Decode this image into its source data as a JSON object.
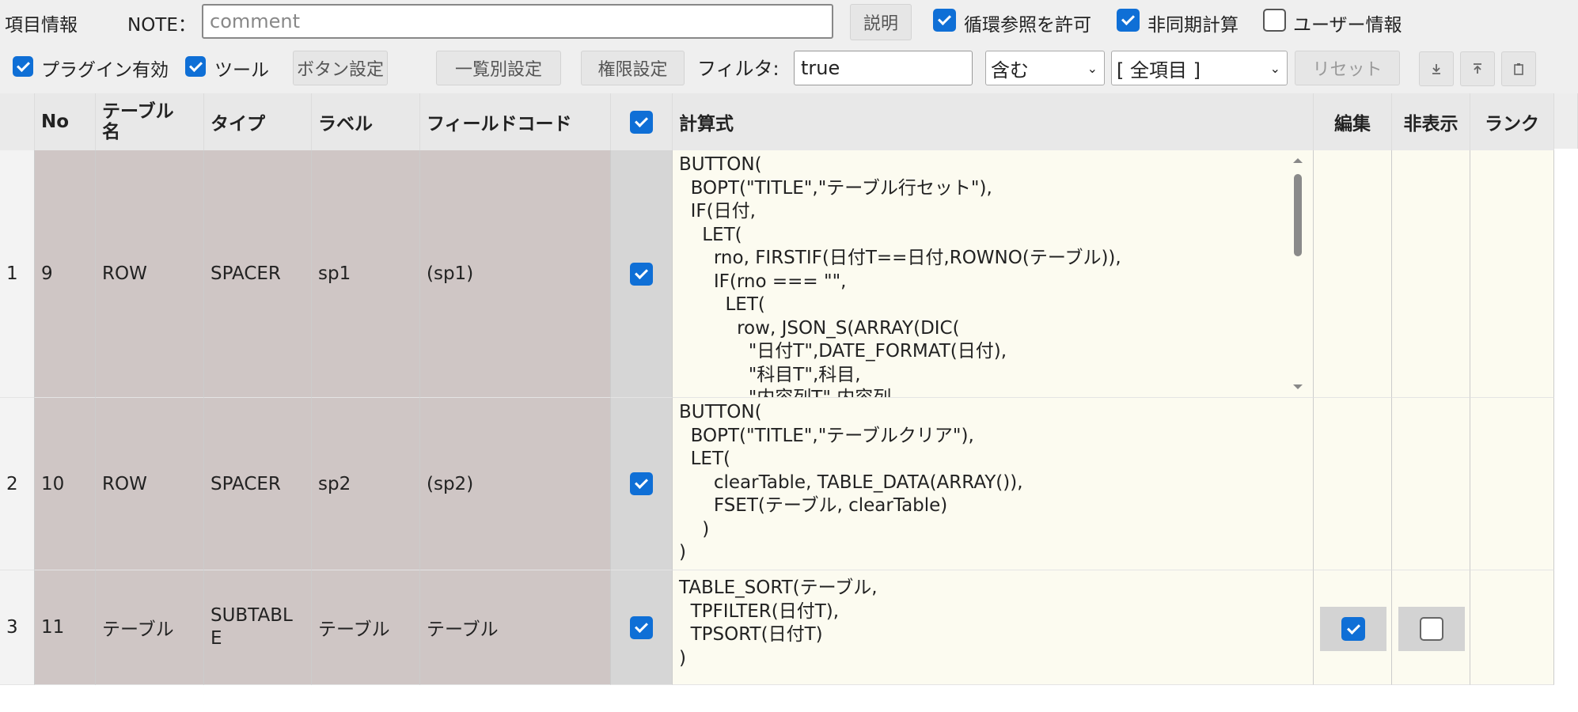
{
  "toolbar1": {
    "item_info_label": "項目情報",
    "note_label": "NOTE：",
    "note_placeholder": "comment",
    "explain_button": "説明",
    "allow_circular_label": "循環参照を許可",
    "async_calc_label": "非同期計算",
    "user_info_label": "ユーザー情報"
  },
  "toolbar2": {
    "plugin_enabled_label": "プラグイン有効",
    "tools_label": "ツール",
    "button_settings": "ボタン設定",
    "list_settings": "一覧別設定",
    "permission_settings": "権限設定",
    "filter_label": "フィルタ:",
    "filter_value": "true",
    "match_select": "含む",
    "scope_select": "[ 全項目 ]",
    "reset_button": "リセット"
  },
  "table": {
    "headers": {
      "no": "No",
      "table_name": "テーブル\n名",
      "type": "タイプ",
      "label": "ラベル",
      "field_code": "フィールドコード",
      "formula": "計算式",
      "edit": "編集",
      "hidden": "非表示",
      "rank": "ランク"
    },
    "rows": [
      {
        "index": "1",
        "no": "9",
        "table_name": "ROW",
        "type": "SPACER",
        "label": "sp1",
        "field_code": "(sp1)",
        "formula": "BUTTON(\n  BOPT(\"TITLE\",\"テーブル行セット\"),\n  IF(日付,\n    LET(\n      rno, FIRSTIF(日付T==日付,ROWNO(テーブル)),\n      IF(rno === \"\",\n        LET(\n          row, JSON_S(ARRAY(DIC(\n            \"日付T\",DATE_FORMAT(日付),\n            \"科目T\",科目,\n            \"内容列T\",内容列,"
      },
      {
        "index": "2",
        "no": "10",
        "table_name": "ROW",
        "type": "SPACER",
        "label": "sp2",
        "field_code": "(sp2)",
        "formula": "BUTTON(\n  BOPT(\"TITLE\",\"テーブルクリア\"),\n  LET(\n      clearTable, TABLE_DATA(ARRAY()),\n      FSET(テーブル, clearTable)\n    )\n)"
      },
      {
        "index": "3",
        "no": "11",
        "table_name": "テーブル",
        "type": "SUBTABL\nE",
        "label": "テーブル",
        "field_code": "テーブル",
        "formula": "TABLE_SORT(テーブル,\n  TPFILTER(日付T),\n  TPSORT(日付T)\n)"
      }
    ]
  }
}
